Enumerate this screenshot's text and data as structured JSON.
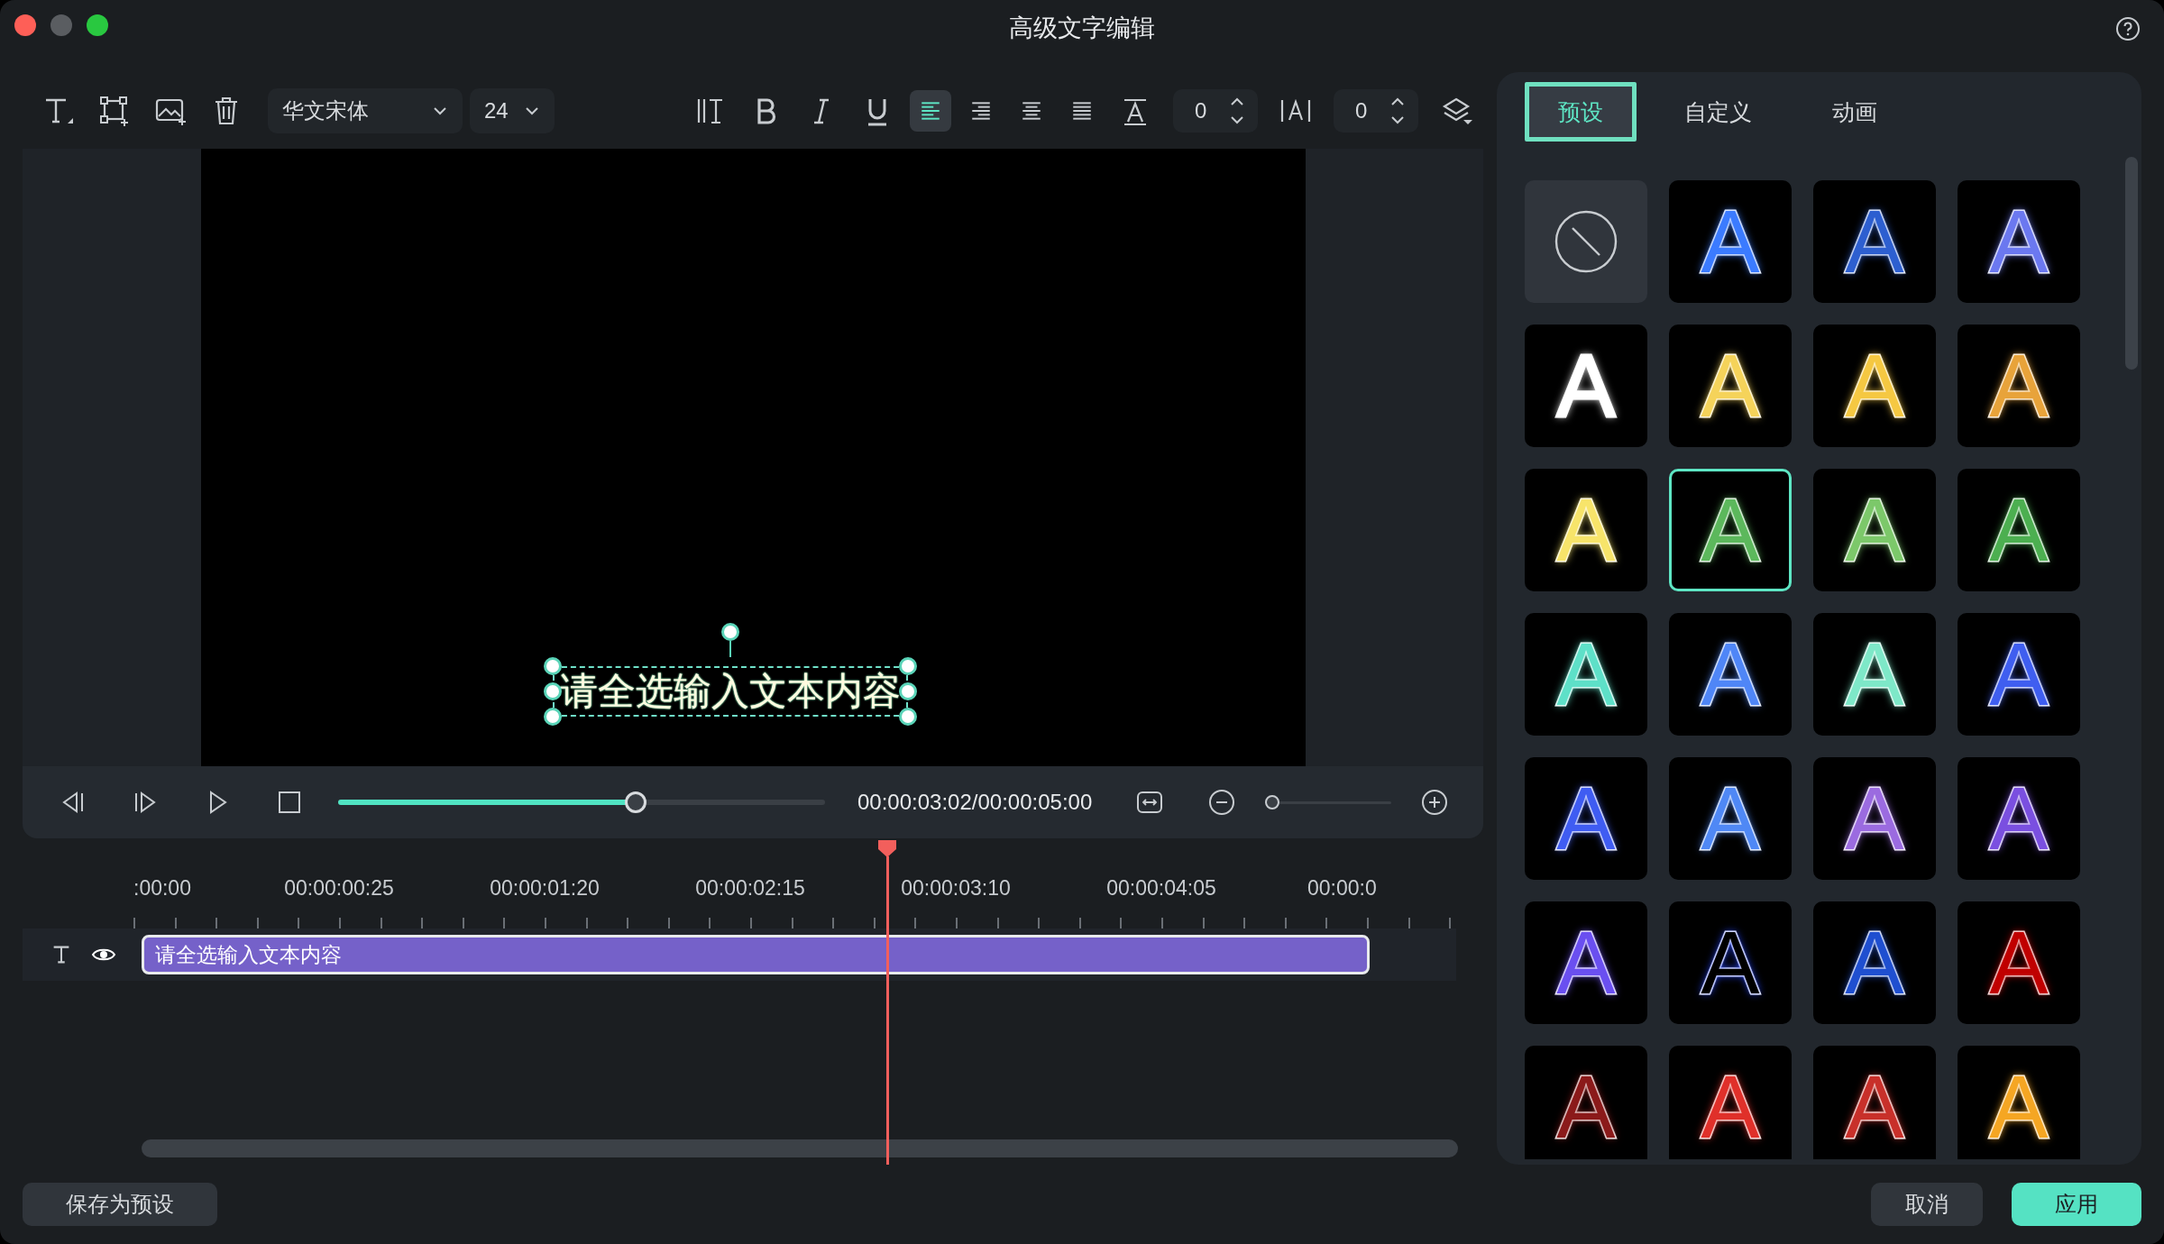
{
  "window": {
    "title": "高级文字编辑"
  },
  "toolbar": {
    "font": "华文宋体",
    "size": "24",
    "alignments": [
      {
        "kind": "left",
        "selected": true
      },
      {
        "kind": "right",
        "selected": false
      },
      {
        "kind": "center",
        "selected": false
      },
      {
        "kind": "justify",
        "selected": false
      }
    ],
    "line_spacing": "0",
    "char_spacing": "0"
  },
  "preview": {
    "text": "请全选输入文本内容"
  },
  "player": {
    "level": 0.61,
    "timecode": "00:00:03:02/00:00:05:00",
    "zoom": {
      "level": 0.03
    }
  },
  "timeline": {
    "ruler": [
      ":00:00",
      "00:00:00:25",
      "00:00:01:20",
      "00:00:02:15",
      "00:00:03:10",
      "00:00:04:05",
      "00:00:0"
    ],
    "track": {
      "text": "请全选输入文本内容"
    }
  },
  "tabs": [
    {
      "label": "预设",
      "selected": true
    },
    {
      "label": "自定义",
      "selected": false
    },
    {
      "label": "动画",
      "selected": false
    }
  ],
  "presets": [
    {
      "kind": "none",
      "selected": false
    },
    {
      "kind": "style",
      "label": "A",
      "color": "#3b7bff",
      "selected": false
    },
    {
      "kind": "style",
      "label": "A",
      "color": "#2d5fd0",
      "selected": false
    },
    {
      "kind": "style",
      "label": "A",
      "color": "#6b78f0",
      "selected": false
    },
    {
      "kind": "style",
      "label": "A",
      "color": "#ffffff",
      "selected": false
    },
    {
      "kind": "style",
      "label": "A",
      "color": "#f5d35a",
      "selected": false
    },
    {
      "kind": "style",
      "label": "A",
      "color": "#f5c842",
      "selected": false
    },
    {
      "kind": "style",
      "label": "A",
      "color": "#e8a33a",
      "selected": false
    },
    {
      "kind": "style",
      "label": "A",
      "color": "#f7e46a",
      "selected": false
    },
    {
      "kind": "style",
      "label": "A",
      "color": "#5cb85c",
      "selected": true
    },
    {
      "kind": "style",
      "label": "A",
      "color": "#7cc86a",
      "selected": false
    },
    {
      "kind": "style",
      "label": "A",
      "color": "#4caf50",
      "selected": false
    },
    {
      "kind": "style",
      "label": "A",
      "color": "#5ee0c8",
      "selected": false
    },
    {
      "kind": "style",
      "label": "A",
      "color": "#4f86f7",
      "selected": false
    },
    {
      "kind": "style",
      "label": "A",
      "color": "#7ee8c8",
      "selected": false
    },
    {
      "kind": "style",
      "label": "A",
      "color": "#3f5ef0",
      "selected": false
    },
    {
      "kind": "style",
      "label": "A",
      "color": "#3f5cf2",
      "selected": false
    },
    {
      "kind": "style",
      "label": "A",
      "color": "#4f88f5",
      "selected": false
    },
    {
      "kind": "style",
      "label": "A",
      "color": "#9b6be0",
      "selected": false
    },
    {
      "kind": "style",
      "label": "A",
      "color": "#7a4fe0",
      "selected": false
    },
    {
      "kind": "style",
      "label": "A",
      "color": "#6a4ff0",
      "selected": false
    },
    {
      "kind": "style",
      "label": "A",
      "color": "#000000",
      "selected": false
    },
    {
      "kind": "style",
      "label": "A",
      "color": "#1f4fd0",
      "selected": false
    },
    {
      "kind": "style",
      "label": "A",
      "color": "#c00000",
      "selected": false
    },
    {
      "kind": "style",
      "label": "A",
      "color": "#8b1a1a",
      "selected": false
    },
    {
      "kind": "style",
      "label": "A",
      "color": "#e0302a",
      "selected": false
    },
    {
      "kind": "style",
      "label": "A",
      "color": "#c8302a",
      "selected": false
    },
    {
      "kind": "style",
      "label": "A",
      "color": "#f5a623",
      "selected": false
    }
  ],
  "footer": {
    "save": "保存为预设",
    "cancel": "取消",
    "apply": "应用"
  }
}
